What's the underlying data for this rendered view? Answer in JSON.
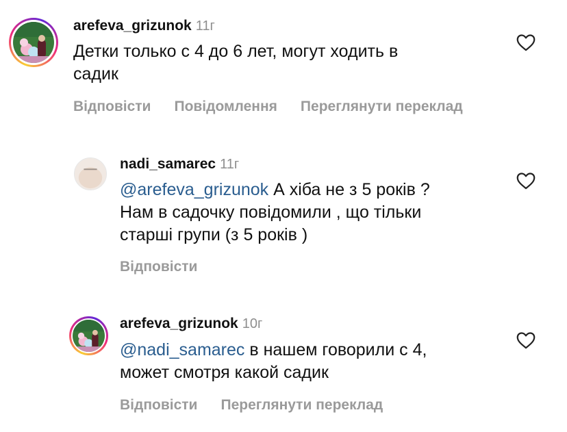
{
  "comments": [
    {
      "username": "arefeva_grizunok",
      "time": "11г",
      "mention": "",
      "text_lines": [
        "Детки только с 4 до 6 лет, могут ходить в",
        "садик"
      ],
      "actions": [
        "Відповісти",
        "Повідомлення",
        "Переглянути переклад"
      ]
    },
    {
      "username": "nadi_samarec",
      "time": "11г",
      "mention": "@arefeva_grizunok",
      "text_first": " А хіба не з 5 років ?",
      "text_lines": [
        "Нам в садочку повідомили , що тільки",
        "старші групи (з 5 років )"
      ],
      "actions": [
        "Відповісти"
      ]
    },
    {
      "username": "arefeva_grizunok",
      "time": "10г",
      "mention": "@nadi_samarec",
      "text_first": " в нашем говорили с 4,",
      "text_lines": [
        "может смотря какой садик"
      ],
      "actions": [
        "Відповісти",
        "Переглянути переклад"
      ]
    }
  ],
  "icons": {
    "like": "heart-outline-icon"
  },
  "colors": {
    "mention": "#2a5d8f",
    "secondary": "#9a9a9a",
    "story_ring": [
      "#f9ce34",
      "#ee2a7b",
      "#6228d7"
    ]
  }
}
